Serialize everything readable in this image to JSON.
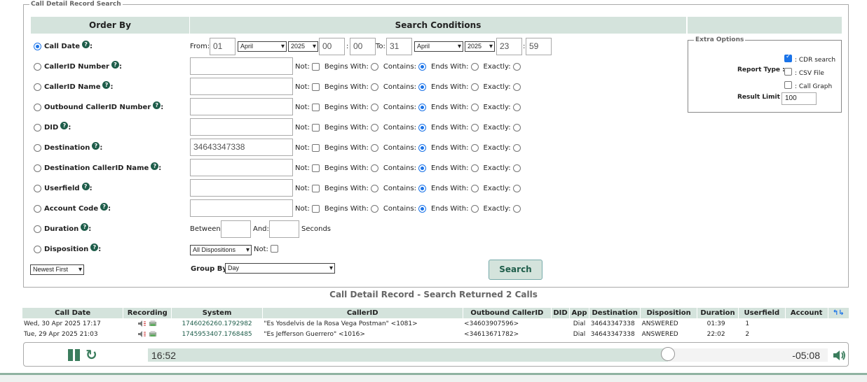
{
  "search": {
    "legend": "Call Detail Record Search",
    "header_order": "Order By",
    "header_conditions": "Search Conditions",
    "call_date": {
      "label": "Call Date",
      "from_label": "From:",
      "from_day": "01",
      "from_month": "April",
      "from_year": "2025",
      "from_hour": "00",
      "from_min": "00",
      "to_label": "To:",
      "to_day": "31",
      "to_month": "April",
      "to_year": "2025",
      "to_hour": "23",
      "to_min": "59",
      "colon": ":"
    },
    "fields": [
      {
        "label": "CallerID Number",
        "value": "",
        "selected": "contains"
      },
      {
        "label": "CallerID Name",
        "value": "",
        "selected": "contains"
      },
      {
        "label": "Outbound CallerID Number",
        "value": "",
        "selected": "contains"
      },
      {
        "label": "DID",
        "value": "",
        "selected": "contains"
      },
      {
        "label": "Destination",
        "value": "34643347338",
        "selected": "contains"
      },
      {
        "label": "Destination CallerID Name",
        "value": "",
        "selected": "contains"
      },
      {
        "label": "Userfield",
        "value": "",
        "selected": "contains"
      },
      {
        "label": "Account Code",
        "value": "",
        "selected": "contains"
      }
    ],
    "match_labels": {
      "not": "Not:",
      "begins": "Begins With:",
      "contains": "Contains:",
      "ends": "Ends With:",
      "exactly": "Exactly:"
    },
    "duration": {
      "label": "Duration",
      "between": "Between:",
      "and": "And:",
      "seconds": "Seconds"
    },
    "disposition": {
      "label": "Disposition",
      "value": "All Dispositions",
      "not": "Not:"
    },
    "order_select": "Newest First",
    "group_by_label": "Group By:",
    "group_by_value": "Day",
    "search_button": "Search",
    "help_glyph": "?"
  },
  "extra_options": {
    "legend": "Extra Options",
    "report_type_label": "Report Type :",
    "cdr_search": ": CDR search",
    "csv_file": ": CSV File",
    "call_graph": ": Call Graph",
    "result_limit_label": "Result Limit :",
    "result_limit_value": "100"
  },
  "results": {
    "title": "Call Detail Record - Search Returned 2 Calls",
    "columns": [
      "Call Date",
      "Recording",
      "System",
      "CallerID",
      "Outbound CallerID",
      "DID",
      "App",
      "Destination",
      "Disposition",
      "Duration",
      "Userfield",
      "Account"
    ],
    "rows": [
      {
        "date": "Wed, 30 Apr 2025 17:17",
        "system": "1746026260.1792982",
        "callerid": "\"Es Yosdelvis de la Rosa Vega Postman\" <1081>",
        "outbound": "<34603907596>",
        "did": "",
        "app": "Dial",
        "destination": "34643347338",
        "disposition": "ANSWERED",
        "duration": "01:39",
        "userfield": "1",
        "account": ""
      },
      {
        "date": "Tue, 29 Apr 2025 21:03",
        "system": "1745953407.1768485",
        "callerid": "\"Es Jefferson Guerrero\" <1016>",
        "outbound": "<34613671782>",
        "did": "",
        "app": "Dial",
        "destination": "34643347338",
        "disposition": "ANSWERED",
        "duration": "22:02",
        "userfield": "2",
        "account": ""
      }
    ]
  },
  "player": {
    "current_time": "16:52",
    "remaining_time": "-05:08",
    "progress": 0.765,
    "accent": "#3b7d5d"
  }
}
